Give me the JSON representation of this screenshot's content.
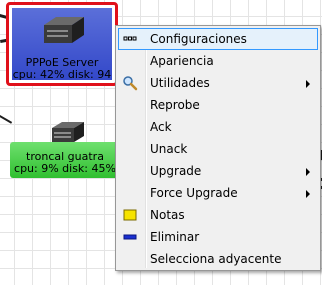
{
  "nodes": {
    "pppoe": {
      "name": "PPPoE Server",
      "stats": "cpu: 42% disk: 94"
    },
    "troncal": {
      "name": "troncal guatra",
      "stats": "cpu: 9% disk: 45%"
    }
  },
  "context_menu": {
    "items": [
      {
        "label": "Configuraciones",
        "icon": "dotted-box-icon",
        "submenu": false,
        "highlighted": true
      },
      {
        "label": "Apariencia",
        "icon": "",
        "submenu": false
      },
      {
        "label": "Utilidades",
        "icon": "magnifier-icon",
        "submenu": true
      },
      {
        "label": "Reprobe",
        "icon": "",
        "submenu": false
      },
      {
        "label": "Ack",
        "icon": "",
        "submenu": false
      },
      {
        "label": "Unack",
        "icon": "",
        "submenu": false
      },
      {
        "label": "Upgrade",
        "icon": "",
        "submenu": true
      },
      {
        "label": "Force Upgrade",
        "icon": "",
        "submenu": true
      },
      {
        "label": "Notas",
        "icon": "note-icon",
        "submenu": false
      },
      {
        "label": "Eliminar",
        "icon": "remove-icon",
        "submenu": false
      },
      {
        "label": "Selecciona adyacente",
        "icon": "",
        "submenu": false
      }
    ]
  },
  "colors": {
    "selection_border": "#e0101a",
    "node_blue": "#3f55cf",
    "node_green": "#3fcc3f",
    "menu_highlight": "#e5f1fb"
  }
}
